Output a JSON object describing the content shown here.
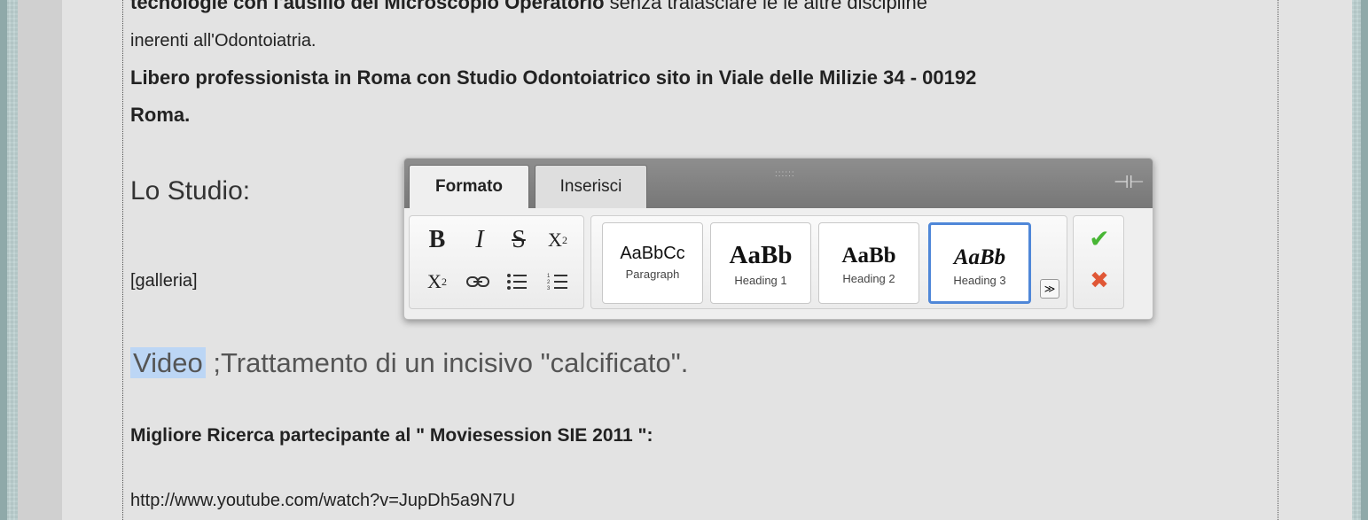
{
  "content": {
    "cut_line_bold": "tecnologie con l'ausilio del Microscopio Operatorio",
    "cut_line_normal": " senza tralasciare le  le altre discipline",
    "line_inerenti": "inerenti all'Odontoiatria.",
    "line_libero": "Libero professionista in Roma con Studio Odontoiatrico sito in Viale delle Milizie 34 - 00192",
    "line_roma": "Roma.",
    "heading_studio": "Lo Studio:",
    "galleria": "[galleria]",
    "video_selected": "Video",
    "video_rest": " ;Trattamento di un incisivo \"calcificato\".",
    "ricerca": "Migliore Ricerca partecipante al \" Moviesession SIE 2011 \":",
    "url": "http://www.youtube.com/watch?v=JupDh5a9N7U"
  },
  "toolbar": {
    "tabs": [
      "Formato",
      "Inserisci"
    ],
    "active_tab": "Formato",
    "drag_grip": "::::::",
    "pin": "⊣⊢",
    "basic": {
      "bold": "B",
      "italic": "I",
      "strike": "S",
      "subscript_base": "X",
      "subscript_small": "2",
      "superscript_base": "X",
      "superscript_small": "2"
    },
    "styles": [
      {
        "sample": "AaBbCc",
        "label": "Paragraph"
      },
      {
        "sample": "AaBb",
        "label": "Heading 1"
      },
      {
        "sample": "AaBb",
        "label": "Heading 2"
      },
      {
        "sample": "AaBb",
        "label": "Heading 3"
      }
    ],
    "selected_style": "Heading 3",
    "more_styles": "≫",
    "confirm": "✔",
    "cancel": "✖"
  },
  "colors": {
    "selection": "#bcd6f5",
    "selected_border": "#4f87d8",
    "confirm_green": "#48b635",
    "cancel_red": "#e05736",
    "background": "#b9cdcd"
  }
}
